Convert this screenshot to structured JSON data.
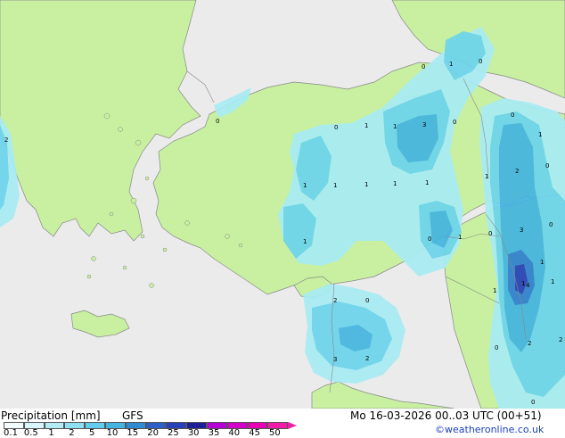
{
  "map": {
    "colors": {
      "sea": "#ebebeb",
      "land": "#c8f0a0",
      "border": "#888888",
      "precip_1": "#a8ecf4",
      "precip_2": "#6cd4ec",
      "precip_3": "#44b4e0",
      "precip_4": "#2f7fd0",
      "precip_5": "#2840b8"
    },
    "point_labels": [
      "0",
      "1",
      "0",
      "0",
      "0",
      "1",
      "3",
      "1",
      "0",
      "1",
      "1",
      "1",
      "1",
      "1",
      "1",
      "1",
      "2",
      "1",
      "1",
      "0",
      "0",
      "1",
      "3",
      "0",
      "0",
      "1",
      "0",
      "1",
      "4",
      "1",
      "2",
      "0",
      "2",
      "3",
      "2",
      "2",
      "0",
      "2",
      "0"
    ]
  },
  "legend": {
    "title": "Precipitation [mm]",
    "model": "GFS",
    "ticks": [
      "0.1",
      "0.5",
      "1",
      "2",
      "5",
      "10",
      "15",
      "20",
      "25",
      "30",
      "35",
      "40",
      "45",
      "50"
    ],
    "colors": [
      "#f5fcfe",
      "#d8f6fb",
      "#b4ecf6",
      "#8ee0f2",
      "#62cdec",
      "#44b4e0",
      "#2f8bd4",
      "#2a5ec8",
      "#2840b8",
      "#1e1e96",
      "#b400d6",
      "#d200c8",
      "#e800b4",
      "#f21ca8"
    ]
  },
  "timestamp": "Mo 16-03-2026 00..03 UTC (00+51)",
  "credit": "©weatheronline.co.uk"
}
